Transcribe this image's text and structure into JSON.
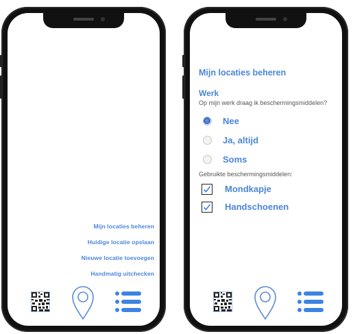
{
  "left_phone": {
    "menu": [
      "Mijn locaties beheren",
      "Huidige locatie opslaan",
      "Nieuwe locatie toevoegen",
      "Handmatig uitchecken"
    ]
  },
  "right_phone": {
    "title": "Mijn locaties beheren",
    "section": "Werk",
    "question": "Op mijn werk draag ik beschermingsmiddelen?",
    "radio_options": [
      {
        "label": "Nee",
        "selected": true
      },
      {
        "label": "Ja, altijd",
        "selected": false
      },
      {
        "label": "Soms",
        "selected": false
      }
    ],
    "used_label": "Gebruikte beschermingsmiddelen:",
    "checkboxes": [
      {
        "label": "Mondkapje",
        "checked": true
      },
      {
        "label": "Handschoenen",
        "checked": true
      }
    ]
  },
  "nav_icons": [
    "qr-code-icon",
    "location-pin-icon",
    "list-menu-icon"
  ],
  "colors": {
    "accent": "#4a86d8",
    "frame": "#111111",
    "text_secondary": "#555555"
  }
}
